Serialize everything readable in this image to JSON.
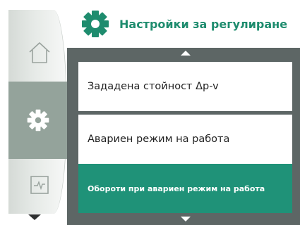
{
  "header": {
    "title": "Настройки за регулиране",
    "icon": "gear-icon",
    "accent_color": "#1e8c6e"
  },
  "sidebar": {
    "items": [
      {
        "icon": "home-icon",
        "active": false
      },
      {
        "icon": "gear-icon",
        "active": true
      },
      {
        "icon": "monitor-icon",
        "active": false
      }
    ]
  },
  "menu": {
    "items": [
      {
        "label": "Зададена стойност Δp-v",
        "selected": false
      },
      {
        "label": "Авариен режим на работа",
        "selected": false
      },
      {
        "label": "Обороти при авариен режим на работа",
        "selected": true
      }
    ],
    "selected_color": "#1f9278"
  }
}
